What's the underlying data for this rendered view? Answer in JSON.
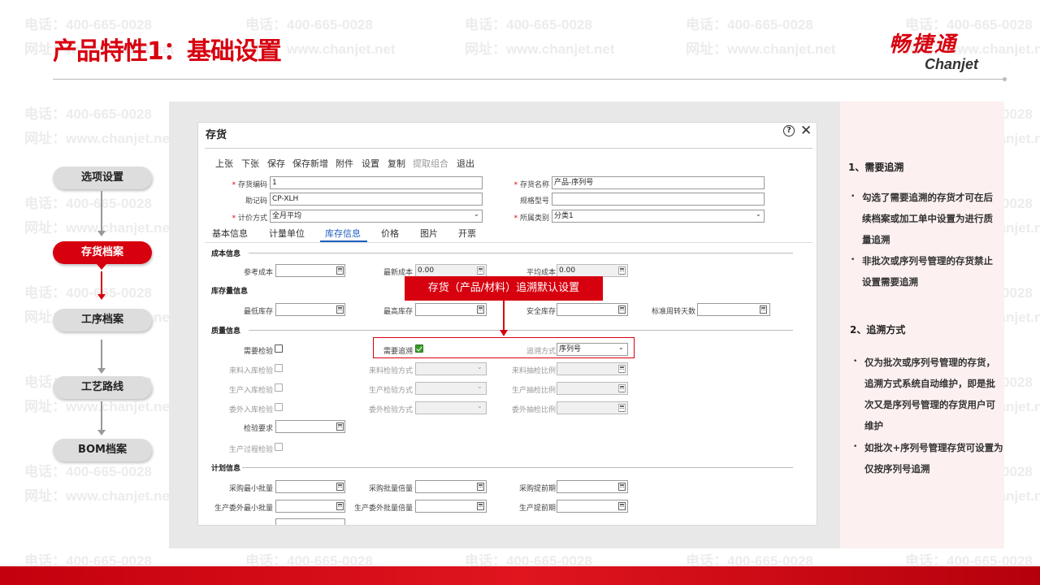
{
  "slide": {
    "title": "产品特性1：基础设置",
    "logo_cn": "畅捷通",
    "logo_en": "Chanjet",
    "watermark_phone": "电话：400-665-0028",
    "watermark_url": "网址：www.chanjet.net"
  },
  "flow": {
    "steps": [
      "选项设置",
      "存货档案",
      "工序档案",
      "工艺路线",
      "BOM档案"
    ],
    "active": "存货档案"
  },
  "window": {
    "title": "存货",
    "help_icon": "?",
    "close_icon": "✕",
    "toolbar": [
      "上张",
      "下张",
      "保存",
      "保存新增",
      "附件",
      "设置",
      "复制",
      "提取组合",
      "退出"
    ],
    "toolbar_disabled": "提取组合",
    "fields": {
      "code_label": "存货编码",
      "code_value": "1",
      "mnemonic_label": "助记码",
      "mnemonic_value": "CP-XLH",
      "pricing_label": "计价方式",
      "pricing_value": "全月平均",
      "name_label": "存货名称",
      "name_value": "产品-序列号",
      "spec_label": "规格型号",
      "spec_value": "",
      "category_label": "所属类别",
      "category_value": "分类1"
    },
    "tabs": [
      "基本信息",
      "计量单位",
      "库存信息",
      "价格",
      "图片",
      "开票"
    ],
    "active_tab": "库存信息",
    "sections": {
      "cost": "成本信息",
      "stock": "库存量信息",
      "quality": "质量信息",
      "plan": "计划信息"
    },
    "cost": {
      "ref_cost": "参考成本",
      "latest_cost": "最新成本",
      "latest_cost_value": "0.00",
      "avg_cost": "平均成本",
      "avg_cost_value": "0.00"
    },
    "stock": {
      "min": "最低库存",
      "max": "最高库存",
      "safe": "安全库存",
      "turnover": "标准周转天数"
    },
    "quality": {
      "need_check": "需要检验",
      "incoming_check": "来料入库检验",
      "production_check": "生产入库检验",
      "outsource_check": "委外入库检验",
      "check_req": "检验要求",
      "process_check": "生产过程检验",
      "need_trace": "需要追溯",
      "incoming_method": "来料检验方式",
      "production_method": "生产检验方式",
      "outsource_method": "委外检验方式",
      "trace_method": "追溯方式",
      "trace_method_value": "序列号",
      "incoming_ratio": "来料抽检比例",
      "production_ratio": "生产抽检比例",
      "outsource_ratio": "委外抽检比例"
    },
    "plan": {
      "purchase_min": "采购最小批量",
      "outsource_min": "生产委外最小批量",
      "purchase_multiple": "采购批量倍量",
      "outsource_multiple": "生产委外批量倍量",
      "purchase_lead": "采购提前期",
      "production_lead": "生产提前期"
    }
  },
  "callout": "存货（产品/材料）追溯默认设置",
  "notes": {
    "h1": "1、需要追溯",
    "b1": "勾选了需要追溯的存货才可在后续档案或加工单中设置为进行质量追溯",
    "b2": "非批次或序列号管理的存货禁止设置需要追溯",
    "h2": "2、追溯方式",
    "b3": "仅为批次或序列号管理的存货，追溯方式系统自动维护，即是批次又是序列号管理的存货用户可维护",
    "b4": "如批次+序列号管理存货可设置为仅按序列号追溯"
  }
}
